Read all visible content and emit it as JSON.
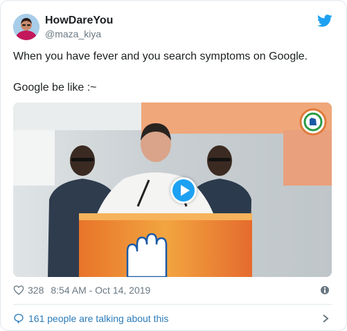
{
  "author": {
    "display_name": "HowDareYou",
    "handle": "@maza_kiya"
  },
  "tweet": {
    "line1": "When you have fever and you search symptoms on Google.",
    "line2": "Google be like :~"
  },
  "media": {
    "type": "video",
    "play_icon": "play-icon"
  },
  "footer": {
    "like_count": "328",
    "timestamp": "8:54 AM - Oct 14, 2019"
  },
  "conversation": {
    "text": "161 people are talking about this"
  },
  "colors": {
    "brand_blue": "#1da1f2",
    "link_blue": "#2b7bb9",
    "muted_gray": "#697882",
    "border": "#e1e8ed"
  }
}
